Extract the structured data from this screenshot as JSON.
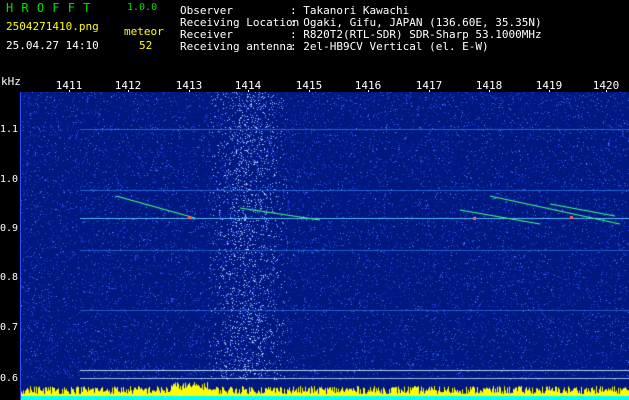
{
  "header": {
    "app_title": "HROFFT",
    "app_version": "1.0.0",
    "filename": "2504271410.png",
    "datetime": "25.04.27 14:10",
    "count_label": "meteor",
    "count_value": "52",
    "fields": [
      {
        "label": "Observer",
        "value": ": Takanori Kawachi"
      },
      {
        "label": "Receiving Location",
        "value": ": Ogaki, Gifu, JAPAN (136.60E, 35.35N)"
      },
      {
        "label": "Receiver",
        "value": ": R820T2(RTL-SDR) SDR-Sharp 53.1000MHz"
      },
      {
        "label": "Receiving antenna",
        "value": ": 2el-HB9CV Vertical (el. E-W)"
      }
    ]
  },
  "axes": {
    "y_unit": "kHz",
    "x_ticks": [
      "1411",
      "1412",
      "1413",
      "1414",
      "1415",
      "1416",
      "1417",
      "1418",
      "1419",
      "1420"
    ],
    "y_ticks": [
      "1.1",
      "1.0",
      "0.9",
      "0.8",
      "0.7",
      "0.6"
    ]
  },
  "colors": {
    "background": "#001880",
    "noise": "#2a50ff",
    "band": "#a0c8ff",
    "header_green": "#00e000",
    "header_yellow": "#ffff00",
    "header_white": "#ffffff",
    "header_cyan": "#00e0ff",
    "meteor_line": "#40ff80",
    "power_fill": "#ffff00",
    "power_base": "#00ffff"
  }
}
